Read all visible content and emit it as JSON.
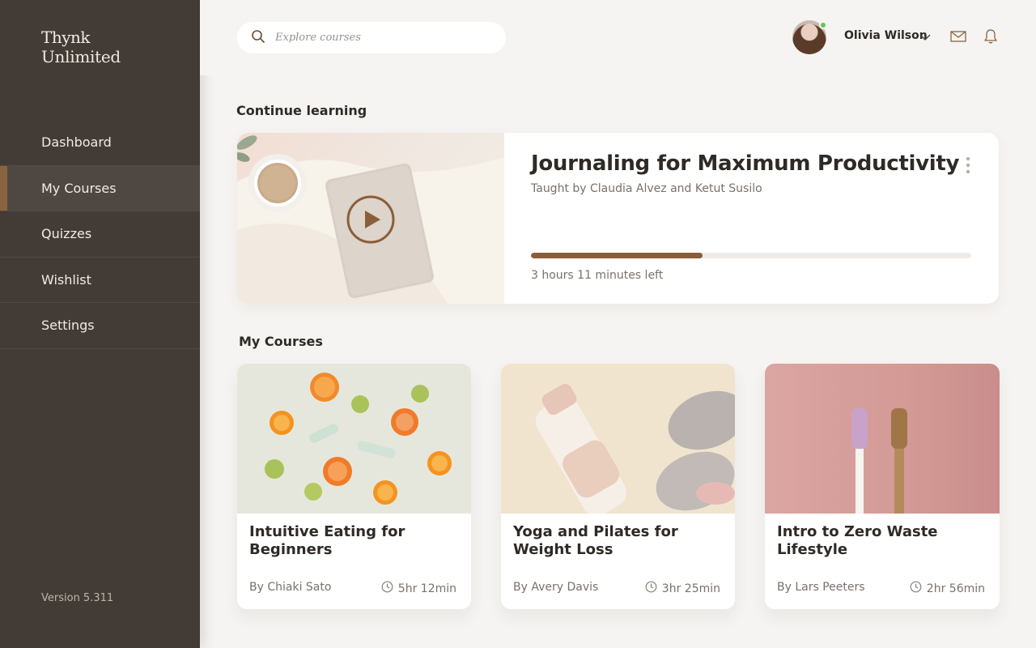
{
  "brand": {
    "line1": "Thynk",
    "line2": "Unlimited"
  },
  "nav": {
    "items": [
      {
        "label": "Dashboard"
      },
      {
        "label": "My Courses"
      },
      {
        "label": "Quizzes"
      },
      {
        "label": "Wishlist"
      },
      {
        "label": "Settings"
      }
    ],
    "active_index": 1
  },
  "version": "Version 5.311",
  "search": {
    "placeholder": "Explore courses",
    "value": ""
  },
  "user": {
    "name": "Olivia Wilson",
    "status": "online"
  },
  "icons": [
    "search-icon",
    "chevron-down-icon",
    "mail-icon",
    "bell-icon",
    "kebab-menu-icon",
    "play-icon",
    "clock-icon"
  ],
  "colors": {
    "sidebar": "#433c36",
    "accent": "#8a5e3a",
    "background": "#f6f4f2",
    "online": "#5fc85a"
  },
  "continue_learning": {
    "heading": "Continue learning",
    "title": "Journaling for Maximum Productivity",
    "instructors": "Taught by Claudia Alvez and Ketut Susilo",
    "progress_fraction": 0.39,
    "time_left": "3 hours 11 minutes left"
  },
  "my_courses": {
    "heading": "My Courses",
    "courses": [
      {
        "title": "Intuitive Eating for Beginners",
        "author": "By Chiaki Sato",
        "duration": "5hr 12min"
      },
      {
        "title": "Yoga and Pilates for Weight Loss",
        "author": "By Avery Davis",
        "duration": "3hr 25min"
      },
      {
        "title": "Intro to Zero Waste Lifestyle",
        "author": "By Lars Peeters",
        "duration": "2hr 56min"
      }
    ]
  }
}
